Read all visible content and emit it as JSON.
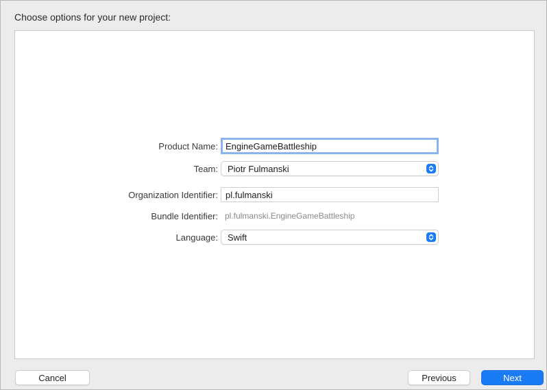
{
  "dialog": {
    "title": "Choose options for your new project:"
  },
  "form": {
    "product_name": {
      "label": "Product Name:",
      "value": "EngineGameBattleship"
    },
    "team": {
      "label": "Team:",
      "value": "Piotr Fulmanski"
    },
    "organization_identifier": {
      "label": "Organization Identifier:",
      "value": "pl.fulmanski"
    },
    "bundle_identifier": {
      "label": "Bundle Identifier:",
      "value": "pl.fulmanski.EngineGameBattleship"
    },
    "language": {
      "label": "Language:",
      "value": "Swift"
    }
  },
  "buttons": {
    "cancel": "Cancel",
    "previous": "Previous",
    "next": "Next"
  },
  "colors": {
    "accent": "#1a7cf5",
    "focus_ring": "#8ab4f0"
  },
  "icons": {
    "popup_indicator": "up-down-chevron-icon"
  }
}
